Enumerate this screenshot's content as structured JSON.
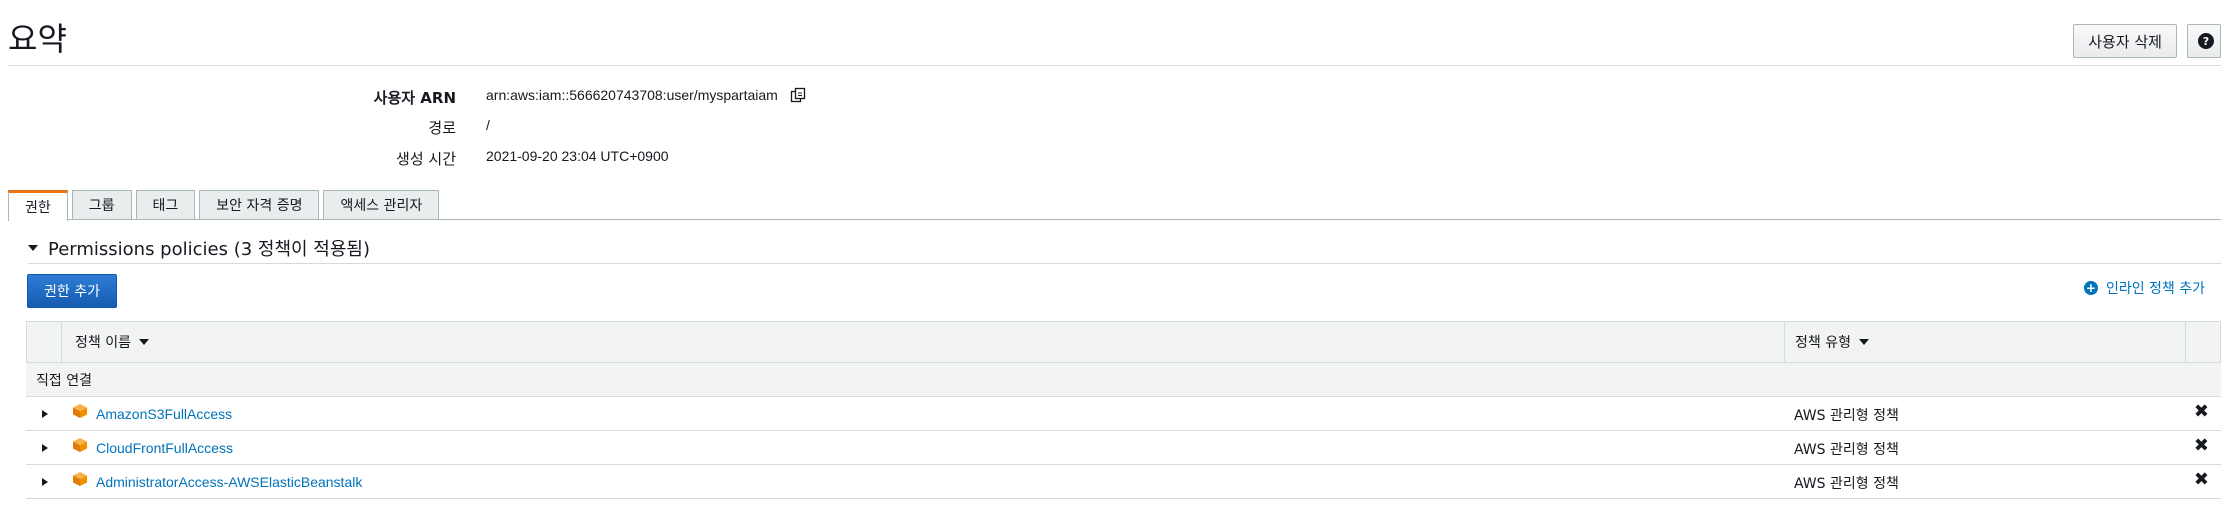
{
  "header": {
    "title": "요약",
    "delete_user_label": "사용자 삭제"
  },
  "summary": {
    "arn_label": "사용자 ARN",
    "arn_value": "arn:aws:iam::566620743708:user/myspartaiam",
    "path_label": "경로",
    "path_value": "/",
    "created_label": "생성 시간",
    "created_value": "2021-09-20 23:04 UTC+0900"
  },
  "tabs": [
    {
      "label": "권한",
      "active": true
    },
    {
      "label": "그룹",
      "active": false
    },
    {
      "label": "태그",
      "active": false
    },
    {
      "label": "보안 자격 증명",
      "active": false
    },
    {
      "label": "액세스 관리자",
      "active": false
    }
  ],
  "permissions": {
    "section_title": "Permissions policies (3 정책이 적용됨)",
    "add_permission_label": "권한 추가",
    "add_inline_label": "인라인 정책 추가",
    "col_name": "정책 이름",
    "col_type": "정책 유형",
    "group_label": "직접 연결",
    "rows": [
      {
        "name": "AmazonS3FullAccess",
        "type": "AWS 관리형 정책"
      },
      {
        "name": "CloudFrontFullAccess",
        "type": "AWS 관리형 정책"
      },
      {
        "name": "AdministratorAccess-AWSElasticBeanstalk",
        "type": "AWS 관리형 정책"
      }
    ]
  },
  "colors": {
    "link": "#0073bb",
    "primary_button": "#1a66c2",
    "active_tab_accent": "#ec7211",
    "policy_icon": "#f29100"
  },
  "icons": [
    "copy-icon",
    "help-icon",
    "caret-down-icon",
    "plus-circle-icon",
    "sort-caret-icon",
    "expand-caret-icon",
    "aws-policy-cube-icon",
    "remove-icon"
  ]
}
